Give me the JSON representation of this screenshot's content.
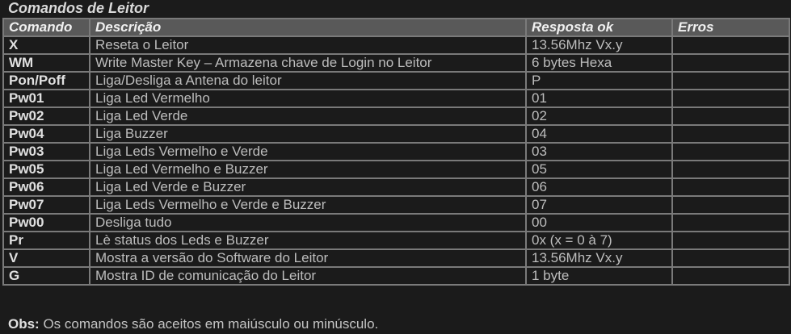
{
  "title": "Comandos de Leitor",
  "headers": {
    "command": "Comando",
    "description": "Descrição",
    "response": "Resposta ok",
    "errors": "Erros"
  },
  "rows": [
    {
      "command": "X",
      "description": "Reseta o Leitor",
      "response": "13.56Mhz Vx.y",
      "errors": ""
    },
    {
      "command": "WM",
      "description": "Write Master Key – Armazena chave de Login no Leitor",
      "response": "6 bytes Hexa",
      "errors": ""
    },
    {
      "command": "Pon/Poff",
      "description": "Liga/Desliga a Antena do leitor",
      "response": "P",
      "errors": ""
    },
    {
      "command": "Pw01",
      "description": "Liga Led Vermelho",
      "response": "01",
      "errors": ""
    },
    {
      "command": "Pw02",
      "description": "Liga Led Verde",
      "response": "02",
      "errors": ""
    },
    {
      "command": "Pw04",
      "description": "Liga Buzzer",
      "response": "04",
      "errors": ""
    },
    {
      "command": "Pw03",
      "description": "Liga Leds Vermelho e Verde",
      "response": "03",
      "errors": ""
    },
    {
      "command": "Pw05",
      "description": "Liga Led Vermelho e Buzzer",
      "response": "05",
      "errors": ""
    },
    {
      "command": "Pw06",
      "description": "Liga Led Verde e Buzzer",
      "response": "06",
      "errors": ""
    },
    {
      "command": "Pw07",
      "description": "Liga Leds Vermelho e Verde e Buzzer",
      "response": "07",
      "errors": ""
    },
    {
      "command": "Pw00",
      "description": "Desliga tudo",
      "response": "00",
      "errors": ""
    },
    {
      "command": "Pr",
      "description": "Lè status dos Leds e Buzzer",
      "response": "0x (x = 0 à 7)",
      "errors": ""
    },
    {
      "command": "V",
      "description": "Mostra a versão do Software do Leitor",
      "response": "13.56Mhz Vx.y",
      "errors": ""
    },
    {
      "command": "G",
      "description": "Mostra ID de comunicação do Leitor",
      "response": "1 byte",
      "errors": ""
    }
  ],
  "obs": {
    "label": "Obs:",
    "text": " Os comandos são aceitos em maiúsculo ou minúsculo."
  }
}
